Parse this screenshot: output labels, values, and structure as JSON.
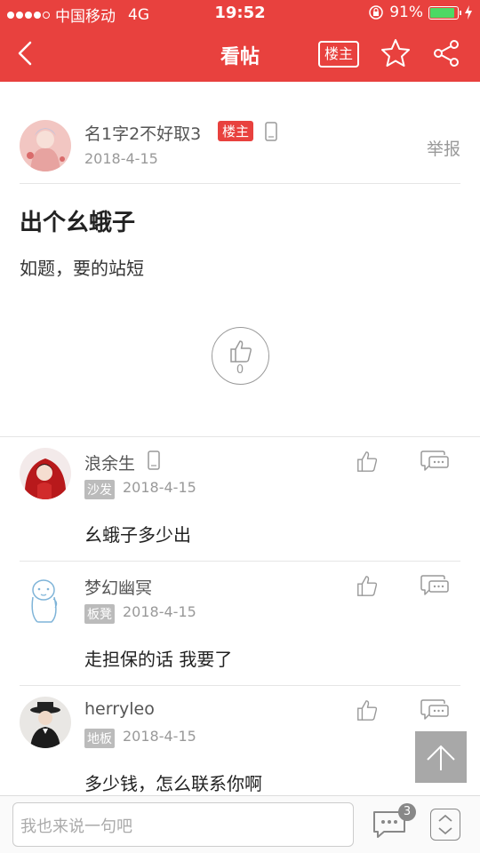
{
  "status_bar": {
    "carrier": "中国移动",
    "network": "4G",
    "time": "19:52",
    "battery_percent": "91%",
    "battery_level": 0.91,
    "battery_color": "#4cd964"
  },
  "nav": {
    "title": "看帖",
    "owner_label": "楼主",
    "back_icon": "chevron-left-icon",
    "star_icon": "star-icon",
    "share_icon": "share-icon"
  },
  "theme": {
    "accent": "#e8413e"
  },
  "post": {
    "author": "名1字2不好取3",
    "owner_badge": "楼主",
    "date": "2018-4-15",
    "report_label": "举报",
    "title": "出个幺蛾子",
    "body": "如题，要的站短",
    "like_count": "0"
  },
  "replies": [
    {
      "author": "浪余生",
      "floor": "沙发",
      "date": "2018-4-15",
      "content": "幺蛾子多少出",
      "has_phone": true
    },
    {
      "author": "梦幻幽冥",
      "floor": "板凳",
      "date": "2018-4-15",
      "content": "走担保的话 我要了",
      "has_phone": false
    },
    {
      "author": "herryleo",
      "floor": "地板",
      "date": "2018-4-15",
      "content": "多少钱，怎么联系你啊",
      "has_phone": false
    }
  ],
  "bottom_bar": {
    "input_placeholder": "我也来说一句吧",
    "comment_count": "3"
  }
}
